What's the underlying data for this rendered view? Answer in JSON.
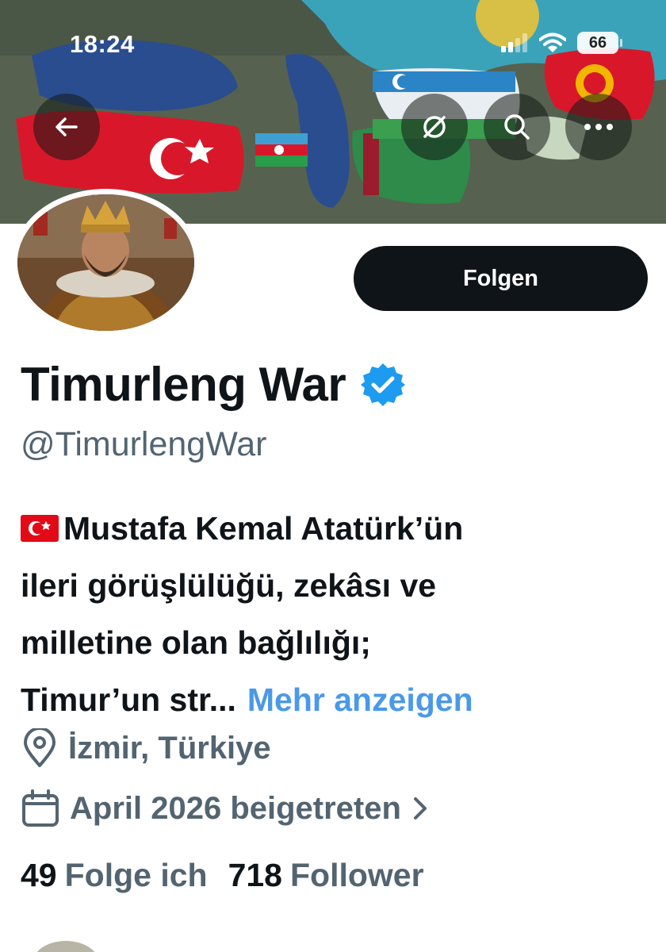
{
  "status_bar": {
    "time": "18:24",
    "battery": "66",
    "icons": [
      "signal-icon",
      "wifi-icon",
      "battery-icon"
    ]
  },
  "header": {
    "buttons": [
      "back-arrow-icon",
      "grok-icon",
      "search-icon",
      "more-icon"
    ]
  },
  "profile": {
    "display_name": "Timurleng War",
    "verified": true,
    "handle": "@TimurlengWar",
    "follow_label": "Folgen",
    "bio_lines": [
      "Mustafa Kemal Atatürk’ün",
      "ileri görüşlülüğü, zekâsı ve",
      "milletine olan bağlılığı;",
      "Timur’un str..."
    ],
    "bio_flag": "flag-turkey-icon",
    "show_more": "Mehr anzeigen",
    "location": "İzmir, Türkiye",
    "joined": "April 2026 beigetreten",
    "following_count": "49",
    "following_label": "Folge ich",
    "followers_count": "718",
    "followers_label": "Follower"
  },
  "colors": {
    "text": "#0f1419",
    "secondary": "#536471",
    "link": "#4a99e9",
    "verified": "#1d9bf0",
    "button": "#0f1419"
  }
}
